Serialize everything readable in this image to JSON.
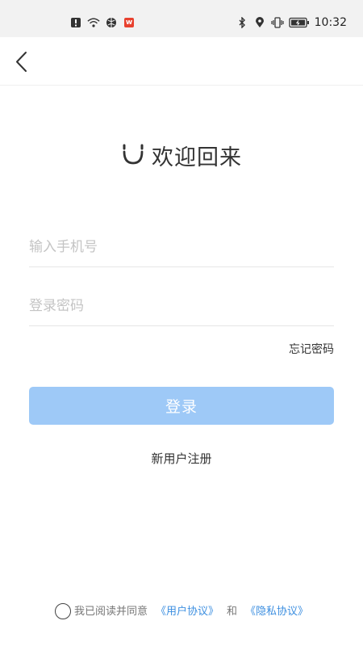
{
  "status_bar": {
    "time": "10:32",
    "left_icons": [
      "alert-icon",
      "wifi-icon",
      "globe-icon",
      "wps-icon"
    ],
    "right_icons": [
      "bluetooth-icon",
      "location-icon",
      "vibrate-icon",
      "battery-icon"
    ],
    "wps_letter": "w"
  },
  "nav": {
    "back_icon": "chevron-left-icon"
  },
  "welcome": {
    "title": "欢迎回来",
    "icon": "smile-icon"
  },
  "form": {
    "phone_placeholder": "输入手机号",
    "phone_value": "",
    "password_placeholder": "登录密码",
    "password_value": "",
    "forgot_label": "忘记密码"
  },
  "login_button": {
    "label": "登录",
    "color": "#9ec9f7"
  },
  "register_link": {
    "label": "新用户注册"
  },
  "agreement": {
    "prefix": "我已阅读并同意",
    "user_agreement": "《用户协议》",
    "conjunction": "和",
    "privacy_policy": "《隐私协议》",
    "link_color": "#3d8fe0",
    "checked": false
  }
}
